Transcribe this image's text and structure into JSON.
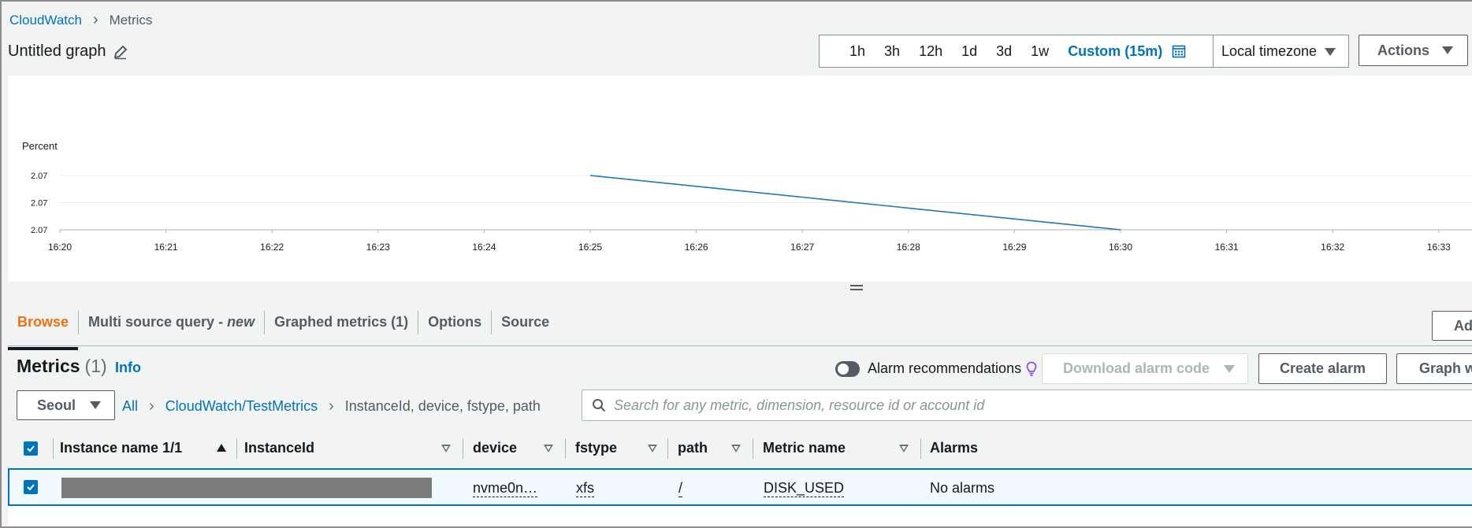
{
  "breadcrumb": {
    "root": "CloudWatch",
    "current": "Metrics"
  },
  "graph": {
    "title": "Untitled graph"
  },
  "time_range": {
    "options": [
      "1h",
      "3h",
      "12h",
      "1d",
      "3d",
      "1w"
    ],
    "custom_label": "Custom (15m)",
    "timezone": "Local timezone",
    "actions_label": "Actions"
  },
  "chart_data": {
    "type": "line",
    "ylabel": "Percent",
    "y_tick_labels": [
      "2.07",
      "2.07",
      "2.07"
    ],
    "x_tick_labels": [
      "16:20",
      "16:21",
      "16:22",
      "16:23",
      "16:24",
      "16:25",
      "16:26",
      "16:27",
      "16:28",
      "16:29",
      "16:30",
      "16:31",
      "16:32",
      "16:33"
    ],
    "series": [
      {
        "color": "#1f77b4",
        "x": [
          "16:25",
          "16:30"
        ],
        "y": [
          2.0705,
          2.0695
        ]
      }
    ],
    "ylim": [
      2.0695,
      2.0705
    ],
    "grid": true
  },
  "tabs": {
    "browse": "Browse",
    "multi_source": "Multi source query -",
    "multi_source_em": "new",
    "graphed": "Graphed metrics (1)",
    "options": "Options",
    "source": "Source",
    "add_label": "Ad"
  },
  "metrics": {
    "title": "Metrics",
    "count": "(1)",
    "info": "Info",
    "alarm_recommendations": "Alarm recommendations",
    "download_alarm_code": "Download alarm code",
    "create_alarm": "Create alarm",
    "graph_with": "Graph w"
  },
  "filter": {
    "region": "Seoul",
    "crumbs": {
      "all": "All",
      "namespace": "CloudWatch/TestMetrics",
      "dimensions": "InstanceId, device, fstype, path"
    },
    "search_placeholder": "Search for any metric, dimension, resource id or account id"
  },
  "table": {
    "headers": {
      "instance_name": "Instance name 1/1",
      "instance_id": "InstanceId",
      "device": "device",
      "fstype": "fstype",
      "path": "path",
      "metric_name": "Metric name",
      "alarms": "Alarms"
    },
    "rows": [
      {
        "device": "nvme0n…",
        "fstype": "xfs",
        "path": "/",
        "metric_name": "DISK_USED",
        "alarms": "No alarms"
      }
    ]
  }
}
